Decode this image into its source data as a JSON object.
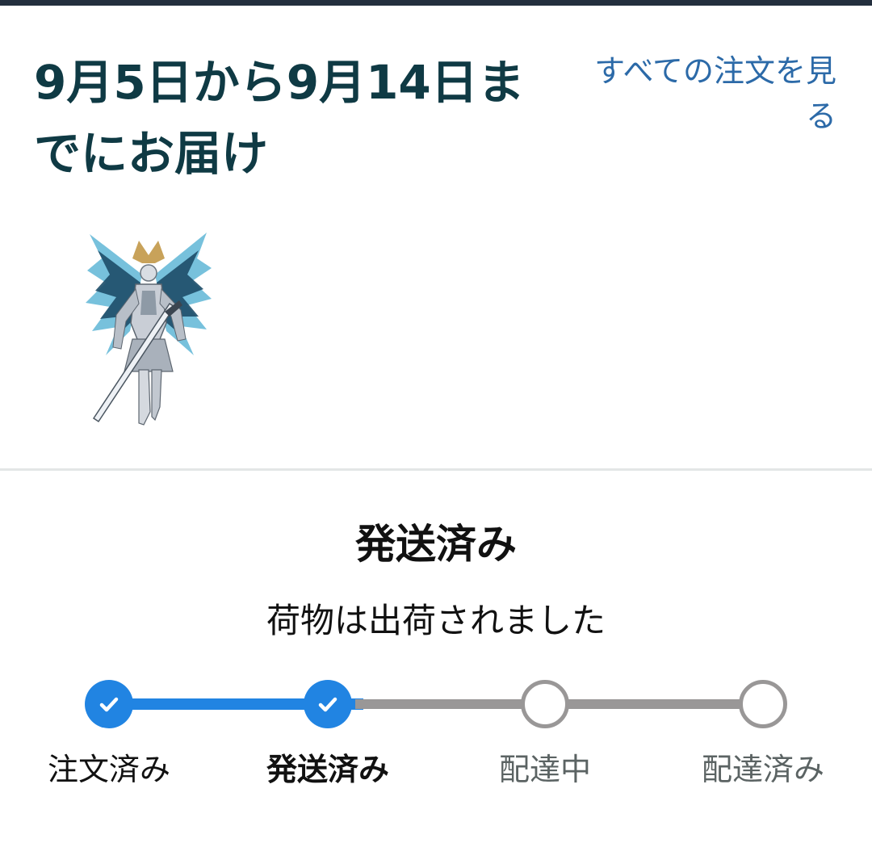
{
  "header": {
    "delivery_title": "9月5日から9月14日までにお届け",
    "all_orders_link": "すべての注文を見る"
  },
  "status": {
    "title": "発送済み",
    "subtitle": "荷物は出荷されました"
  },
  "tracker": {
    "steps": [
      {
        "label": "注文済み",
        "state": "done"
      },
      {
        "label": "発送済み",
        "state": "current"
      },
      {
        "label": "配達中",
        "state": "todo"
      },
      {
        "label": "配達済み",
        "state": "todo"
      }
    ]
  },
  "colors": {
    "accent": "#2184e2",
    "title": "#0f3a44",
    "link": "#2c6aa8",
    "inactive": "#999797"
  },
  "icons": {
    "step_done": "check-icon",
    "step_todo": "empty-circle-icon"
  }
}
